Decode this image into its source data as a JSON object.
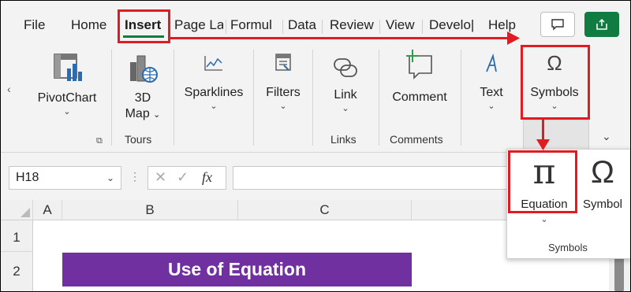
{
  "tabs": {
    "file": "File",
    "home": "Home",
    "insert": "Insert",
    "page_layout": "Page La",
    "formulas": "Formul",
    "data": "Data",
    "review": "Review",
    "view": "View",
    "developer": "Develo|",
    "help": "Help"
  },
  "ribbon": {
    "scroll_left": "‹",
    "pivotchart": "PivotChart",
    "map_line1": "3D",
    "map_line2": "Map",
    "sparklines": "Sparklines",
    "filters": "Filters",
    "link": "Link",
    "comment": "Comment",
    "text": "Text",
    "symbols": "Symbols",
    "groups": {
      "tours": "Tours",
      "links": "Links",
      "comments": "Comments"
    }
  },
  "formula_bar": {
    "name_box": "H18",
    "fx": "fx",
    "formula_value": ""
  },
  "grid": {
    "columns": [
      "A",
      "B",
      "C"
    ],
    "rows": [
      "1",
      "2"
    ],
    "title_cell": "Use of Equation"
  },
  "symbols_dropdown": {
    "equation_glyph": "π",
    "equation_label": "Equation",
    "symbol_glyph": "Ω",
    "symbol_label": "Symbol",
    "group_label": "Symbols"
  },
  "colors": {
    "accent_green": "#107c41",
    "highlight_red": "#e01b22",
    "title_fill": "#7030a0"
  }
}
